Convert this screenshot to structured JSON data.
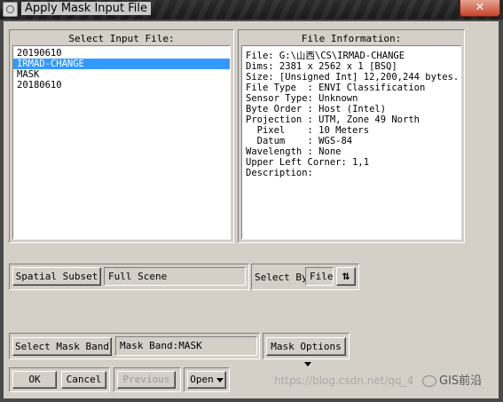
{
  "window": {
    "title": "Apply Mask Input File",
    "close_label": "✕"
  },
  "input_files": {
    "heading": "Select Input File:",
    "items": [
      "20190610",
      "IRMAD-CHANGE",
      "MASK",
      "20180610"
    ],
    "selected_index": 1
  },
  "file_info": {
    "heading": "File Information:",
    "lines": [
      "File: G:\\山西\\CS\\IRMAD-CHANGE",
      "Dims: 2381 x 2562 x 1 [BSQ]",
      "Size: [Unsigned Int] 12,200,244 bytes.",
      "File Type  : ENVI Classification",
      "Sensor Type: Unknown",
      "Byte Order : Host (Intel)",
      "Projection : UTM, Zone 49 North",
      "  Pixel    : 10 Meters",
      "  Datum    : WGS-84",
      "Wavelength : None",
      "Upper Left Corner: 1,1",
      "Description:"
    ]
  },
  "spatial_subset": {
    "button": "Spatial Subset",
    "value": "Full Scene"
  },
  "select_by": {
    "label": "Select By",
    "value": "File",
    "sort_icon": "⇅"
  },
  "mask_band": {
    "button": "Select Mask Band",
    "value": "Mask Band:MASK"
  },
  "mask_options": {
    "label": "Mask Options"
  },
  "actions": {
    "ok": "OK",
    "cancel": "Cancel",
    "previous": "Previous",
    "open": "Open"
  },
  "watermark": {
    "url": "https://blog.csdn.net/qq_4",
    "brand": "GIS前沿"
  }
}
